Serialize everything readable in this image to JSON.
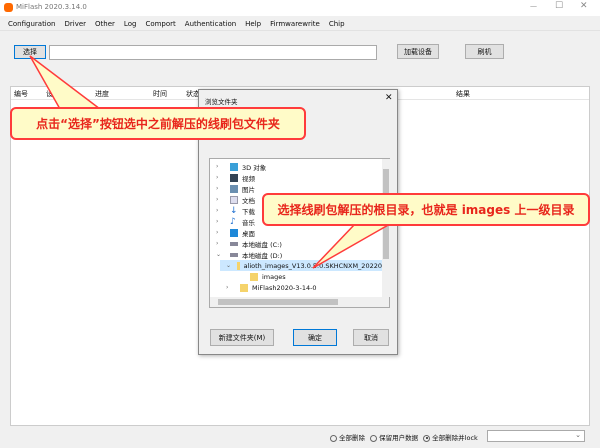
{
  "app": {
    "title": "MiFlash 2020.3.14.0",
    "brand_color": "#ff6900"
  },
  "menu": [
    "Configuration",
    "Driver",
    "Other",
    "Log",
    "Comport",
    "Authentication",
    "Help",
    "Firmwarewrite",
    "Chip"
  ],
  "toolbar": {
    "select_label": "选择",
    "path_value": "",
    "load_device_label": "加载设备",
    "flash_label": "刷机"
  },
  "table": {
    "columns": [
      "编号",
      "设备",
      "进度",
      "时间",
      "状态",
      "结果"
    ]
  },
  "dialog": {
    "title": "浏览文件夹",
    "tree": [
      {
        "label": "3D 对象",
        "icon": "3d-objects-icon"
      },
      {
        "label": "视频",
        "icon": "video-icon"
      },
      {
        "label": "图片",
        "icon": "pictures-icon"
      },
      {
        "label": "文档",
        "icon": "documents-icon"
      },
      {
        "label": "下载",
        "icon": "download-icon"
      },
      {
        "label": "音乐",
        "icon": "music-icon"
      },
      {
        "label": "桌面",
        "icon": "desktop-icon"
      },
      {
        "label": "本地磁盘 (C:)",
        "icon": "drive-icon"
      },
      {
        "label": "本地磁盘 (D:)",
        "icon": "drive-icon"
      },
      {
        "label": "alioth_images_V13.0.5.0.SKHCNXM_20220",
        "icon": "folder-icon"
      },
      {
        "label": "images",
        "icon": "folder-icon"
      },
      {
        "label": "MiFlash2020-3-14-0",
        "icon": "folder-icon"
      }
    ],
    "new_folder_label": "新建文件夹(M)",
    "ok_label": "确定",
    "cancel_label": "取消"
  },
  "callouts": {
    "first": "点击“选择”按钮选中之前解压的线刷包文件夹",
    "second": "选择线刷包解压的根目录，也就是 images 上一级目录"
  },
  "bottom": {
    "options": [
      "全部删除",
      "保留用户数据",
      "全部删除并lock"
    ],
    "selected": "全部删除并lock"
  }
}
